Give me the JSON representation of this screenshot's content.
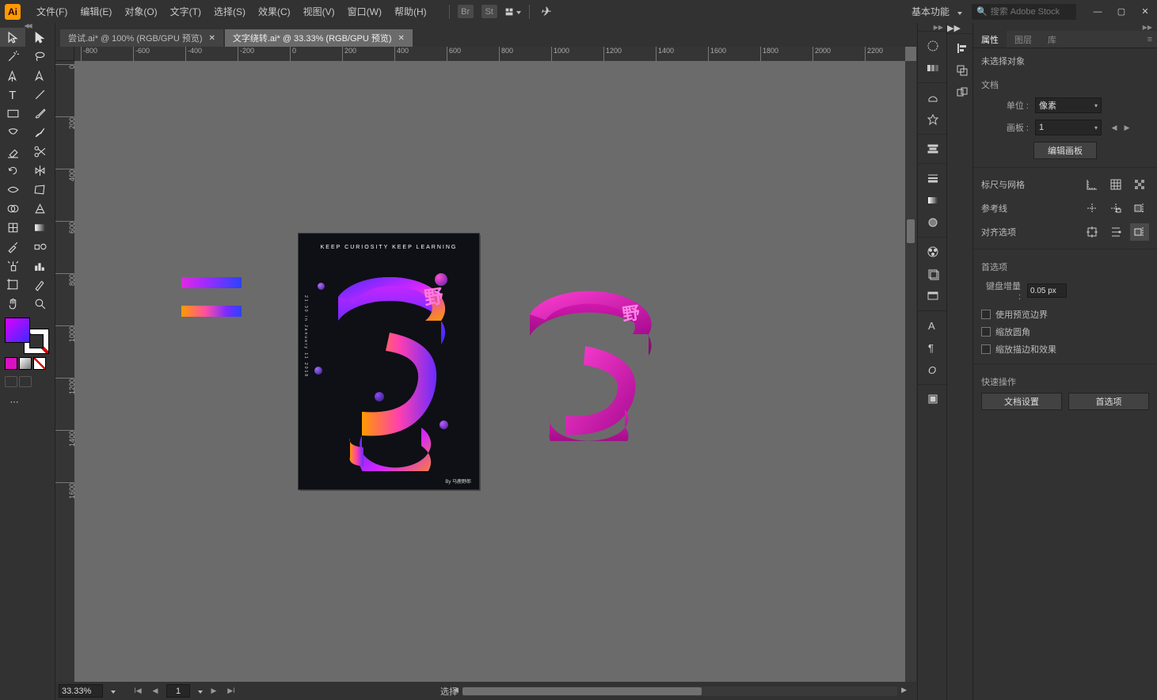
{
  "menubar": {
    "items": [
      "文件(F)",
      "编辑(E)",
      "对象(O)",
      "文字(T)",
      "选择(S)",
      "效果(C)",
      "视图(V)",
      "窗口(W)",
      "帮助(H)"
    ],
    "workspace": "基本功能",
    "search_placeholder": "搜索 Adobe Stock"
  },
  "doctabs": [
    {
      "label": "尝试.ai* @ 100% (RGB/GPU 预览)",
      "active": false
    },
    {
      "label": "文字绕转.ai* @ 33.33% (RGB/GPU 预览)",
      "active": true
    }
  ],
  "ruler_h": [
    "-800",
    "-600",
    "-400",
    "-200",
    "0",
    "200",
    "400",
    "600",
    "800",
    "1000",
    "1200",
    "1400",
    "1600",
    "1800",
    "2000",
    "2200"
  ],
  "ruler_v": [
    "0",
    "200",
    "400",
    "600",
    "800",
    "1000",
    "1200",
    "1400",
    "1600"
  ],
  "artboard": {
    "top_text": "KEEP CURIOSITY KEEP LEARNING",
    "side_text": "21:30 in January 11 2018",
    "by": "By 马鹿野郎"
  },
  "statusbar": {
    "zoom": "33.33%",
    "artboard_num": "1",
    "mode": "选择"
  },
  "panel": {
    "tabs": [
      "属性",
      "图层",
      "库"
    ],
    "no_sel": "未选择对象",
    "section_doc": "文档",
    "unit_label": "单位 :",
    "unit_value": "像素",
    "artboard_label": "画板 :",
    "artboard_value": "1",
    "edit_artboards": "编辑画板",
    "rulers_grid": "标尺与网格",
    "guides": "参考线",
    "align": "对齐选项",
    "prefs": "首选项",
    "key_inc_label": "键盘增量 :",
    "key_inc_value": "0.05 px",
    "use_preview": "使用预览边界",
    "scale_corners": "缩放圆角",
    "scale_strokes": "缩放描边和效果",
    "quick": "快速操作",
    "btn_doc_setup": "文档设置",
    "btn_prefs": "首选项"
  }
}
